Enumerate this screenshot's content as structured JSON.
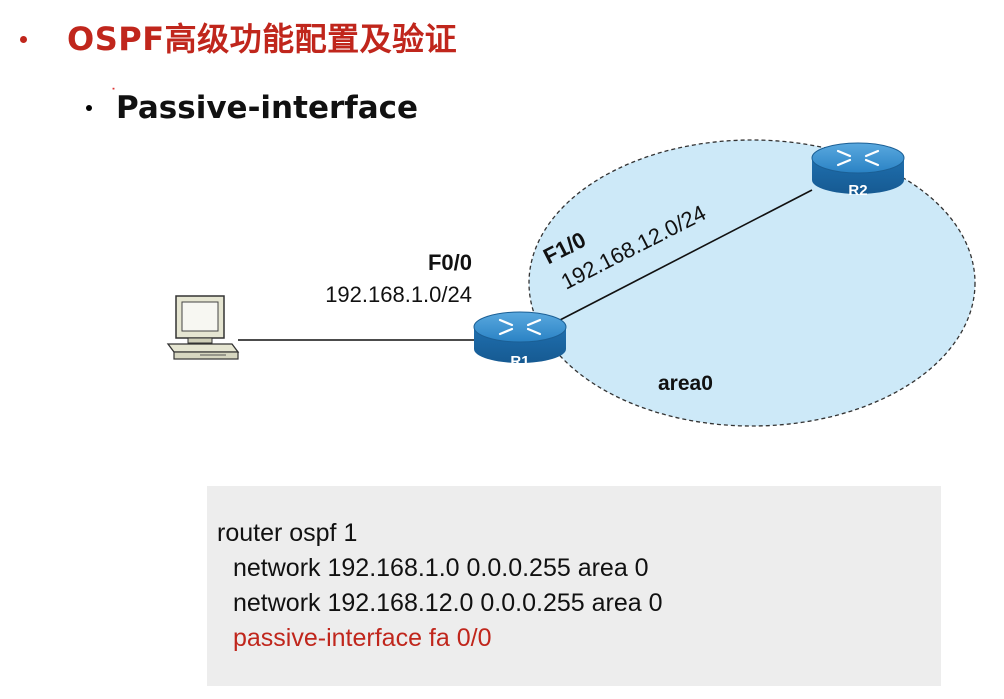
{
  "slide": {
    "title": "OSPF高级功能配置及验证",
    "subtitle": "Passive-interface"
  },
  "diagram": {
    "area_label": "area0",
    "left_interface": "F0/0",
    "left_network": "192.168.1.0/24",
    "right_interface": "F1/0",
    "right_network": "192.168.12.0/24",
    "router1_name": "R1",
    "router2_name": "R2",
    "colors": {
      "area_fill": "#cde9f8",
      "router_blue": "#1f78b8"
    }
  },
  "config": {
    "lines": [
      "router ospf 1",
      "network 192.168.1.0 0.0.0.255 area 0",
      "network 192.168.12.0 0.0.0.255 area 0",
      "passive-interface fa 0/0"
    ],
    "highlight_color": "#c0261c"
  }
}
